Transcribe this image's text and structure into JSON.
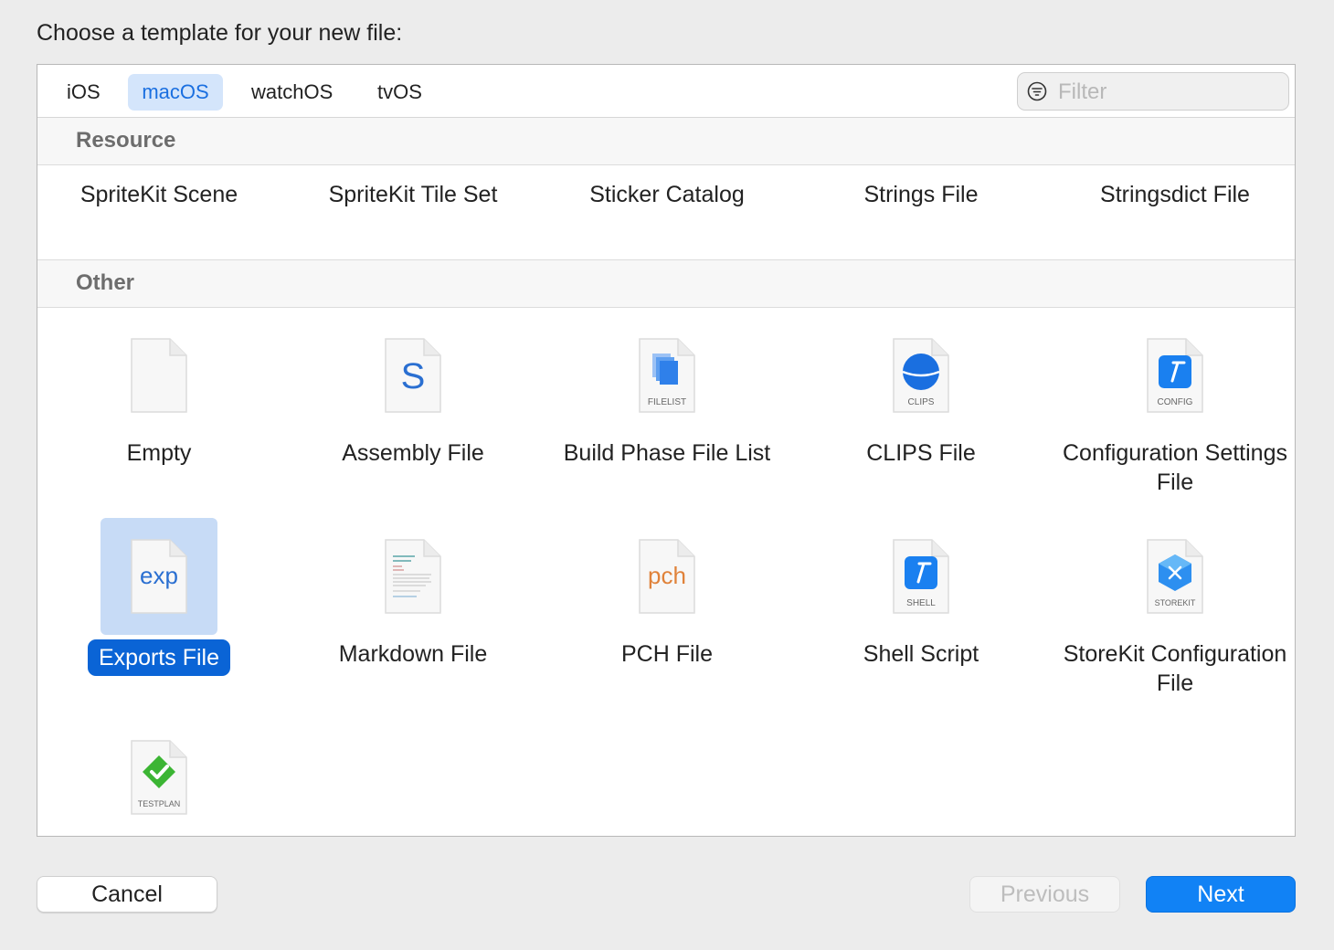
{
  "dialog": {
    "prompt": "Choose a template for your new file:"
  },
  "tabs": [
    {
      "label": "iOS",
      "selected": false
    },
    {
      "label": "macOS",
      "selected": true
    },
    {
      "label": "watchOS",
      "selected": false
    },
    {
      "label": "tvOS",
      "selected": false
    }
  ],
  "filter": {
    "placeholder": "Filter",
    "value": ""
  },
  "sections": {
    "resource": {
      "title": "Resource",
      "items": [
        "SpriteKit Scene",
        "SpriteKit Tile Set",
        "Sticker Catalog",
        "Strings File",
        "Stringsdict File"
      ]
    },
    "other": {
      "title": "Other",
      "items": [
        {
          "label": "Empty",
          "icon": "blank-document-icon"
        },
        {
          "label": "Assembly File",
          "icon": "assembly-s-document-icon",
          "glyph": "S"
        },
        {
          "label": "Build Phase File List",
          "icon": "filelist-document-icon",
          "badge": "FILELIST"
        },
        {
          "label": "CLIPS File",
          "icon": "clips-document-icon",
          "badge": "CLIPS"
        },
        {
          "label": "Configuration Settings File",
          "icon": "config-document-icon",
          "badge": "CONFIG"
        },
        {
          "label": "Exports File",
          "icon": "exp-document-icon",
          "glyph": "exp",
          "selected": true
        },
        {
          "label": "Markdown File",
          "icon": "markdown-document-icon"
        },
        {
          "label": "PCH File",
          "icon": "pch-document-icon",
          "glyph": "pch"
        },
        {
          "label": "Shell Script",
          "icon": "shell-document-icon",
          "badge": "SHELL"
        },
        {
          "label": "StoreKit Configuration File",
          "icon": "storekit-document-icon",
          "badge": "STOREKIT"
        },
        {
          "label": "",
          "icon": "testplan-document-icon",
          "badge": "TESTPLAN"
        }
      ]
    }
  },
  "buttons": {
    "cancel": "Cancel",
    "previous": "Previous",
    "next": "Next"
  },
  "colors": {
    "accent": "#1182f5",
    "selection_fill": "#c7dbf6",
    "selection_label": "#0a64d6",
    "tab_selected_bg": "#d4e5fb"
  }
}
